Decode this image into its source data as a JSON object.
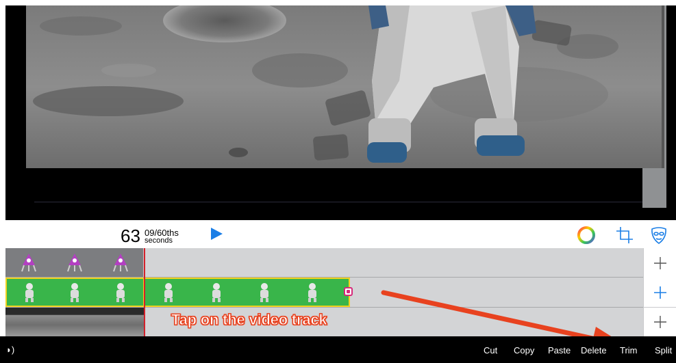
{
  "timecode": {
    "seconds": "63",
    "fraction": "09/60ths",
    "unit": "seconds"
  },
  "toolbar_icons": [
    "play-icon",
    "color-wheel-icon",
    "crop-icon",
    "mask-icon"
  ],
  "tracks": [
    {
      "name": "overlay-track",
      "thumbnail": "alien-lander",
      "frames": 3
    },
    {
      "name": "video-track",
      "thumbnail": "astronaut-greenscreen",
      "frames": 7,
      "selected": true
    },
    {
      "name": "background-track",
      "thumbnail": "moon-surface",
      "frames": 3
    }
  ],
  "annotation": {
    "text": "Tap on the video track",
    "color": "#e8421f"
  },
  "edit_menu": {
    "cut": "Cut",
    "copy": "Copy",
    "paste": "Paste",
    "delete": "Delete",
    "trim": "Trim",
    "split": "Split"
  },
  "colors": {
    "accent": "#1a7ee6",
    "selection": "#f3d21e",
    "greenscreen": "#39b54a",
    "playhead": "#d3202a"
  }
}
